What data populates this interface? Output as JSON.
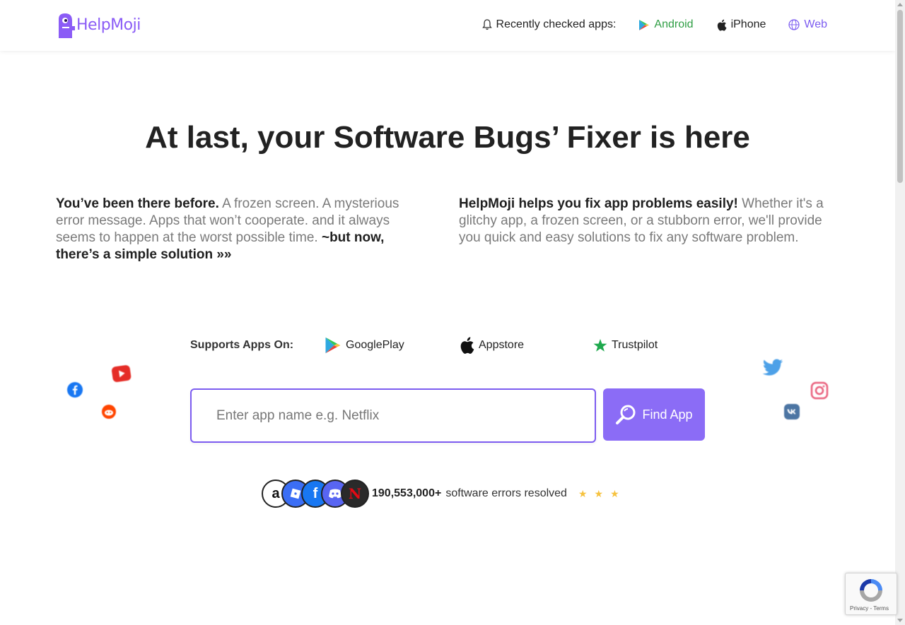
{
  "brand": {
    "name": "HelpMoji",
    "color": "#8b5cf6"
  },
  "nav": {
    "label": "Recently checked apps:",
    "links": [
      {
        "label": "Android",
        "color": "#2f9e44",
        "icon": "google-play-icon"
      },
      {
        "label": "iPhone",
        "color": "#222222",
        "icon": "apple-icon"
      },
      {
        "label": "Web",
        "color": "#7c5cf0",
        "icon": "globe-www-icon"
      }
    ]
  },
  "hero": {
    "title": "At last, your Software Bugs’ Fixer is here",
    "left": {
      "lead": "You’ve been there before.",
      "body": " A frozen screen. A mysterious error message. Apps that won’t cooperate. and it always seems to happen at the worst possible time. ",
      "cta": "~but now, there’s a simple solution »»"
    },
    "right": {
      "lead": "HelpMoji helps you fix app problems easily!",
      "body": " Whether it's a glitchy app, a frozen screen, or a stubborn error, we'll provide you quick and easy solutions to fix any software problem."
    }
  },
  "supports": {
    "label": "Supports Apps On:",
    "items": [
      {
        "label": "GooglePlay",
        "icon": "google-play-icon"
      },
      {
        "label": "Appstore",
        "icon": "apple-icon"
      },
      {
        "label": "Trustpilot",
        "icon": "trustpilot-star-icon"
      }
    ]
  },
  "search": {
    "placeholder": "Enter app name e.g. Netflix",
    "button_label": "Find App",
    "accent": "#8b6cf6"
  },
  "stats": {
    "count": "190,553,000+",
    "text": "software errors resolved",
    "stars": 3,
    "avatars": [
      "amazon-icon",
      "roblox-icon",
      "facebook-icon",
      "discord-icon",
      "netflix-icon"
    ]
  },
  "floating_icons": [
    "facebook-icon",
    "youtube-icon",
    "reddit-icon",
    "twitter-icon",
    "instagram-icon",
    "vk-icon"
  ],
  "recaptcha": {
    "links": "Privacy - Terms"
  }
}
